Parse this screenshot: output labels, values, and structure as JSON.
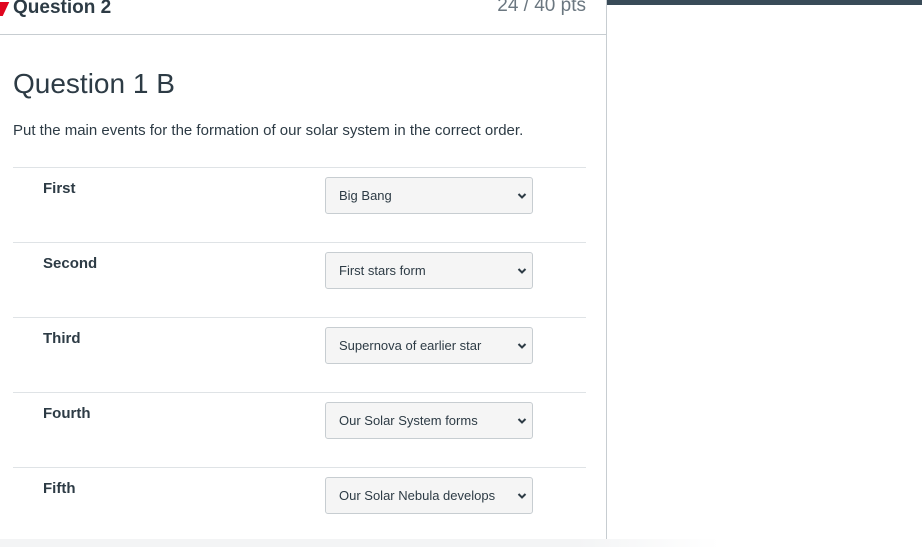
{
  "question": {
    "header_name": "Question 2",
    "points": "24 / 40 pts",
    "title": "Question 1 B",
    "prompt": "Put the main events for the formation of our solar system in the correct order."
  },
  "rows": [
    {
      "label": "First",
      "selected": "Big Bang"
    },
    {
      "label": "Second",
      "selected": "First stars form"
    },
    {
      "label": "Third",
      "selected": "Supernova of earlier star"
    },
    {
      "label": "Fourth",
      "selected": "Our Solar System forms"
    },
    {
      "label": "Fifth",
      "selected": "Our Solar Nebula develops"
    }
  ],
  "colors": {
    "flag": "#e0061f",
    "text": "#2d3b45",
    "top_bar": "#394b58"
  },
  "icons": [
    "chevron-down-icon",
    "flag-marker"
  ]
}
